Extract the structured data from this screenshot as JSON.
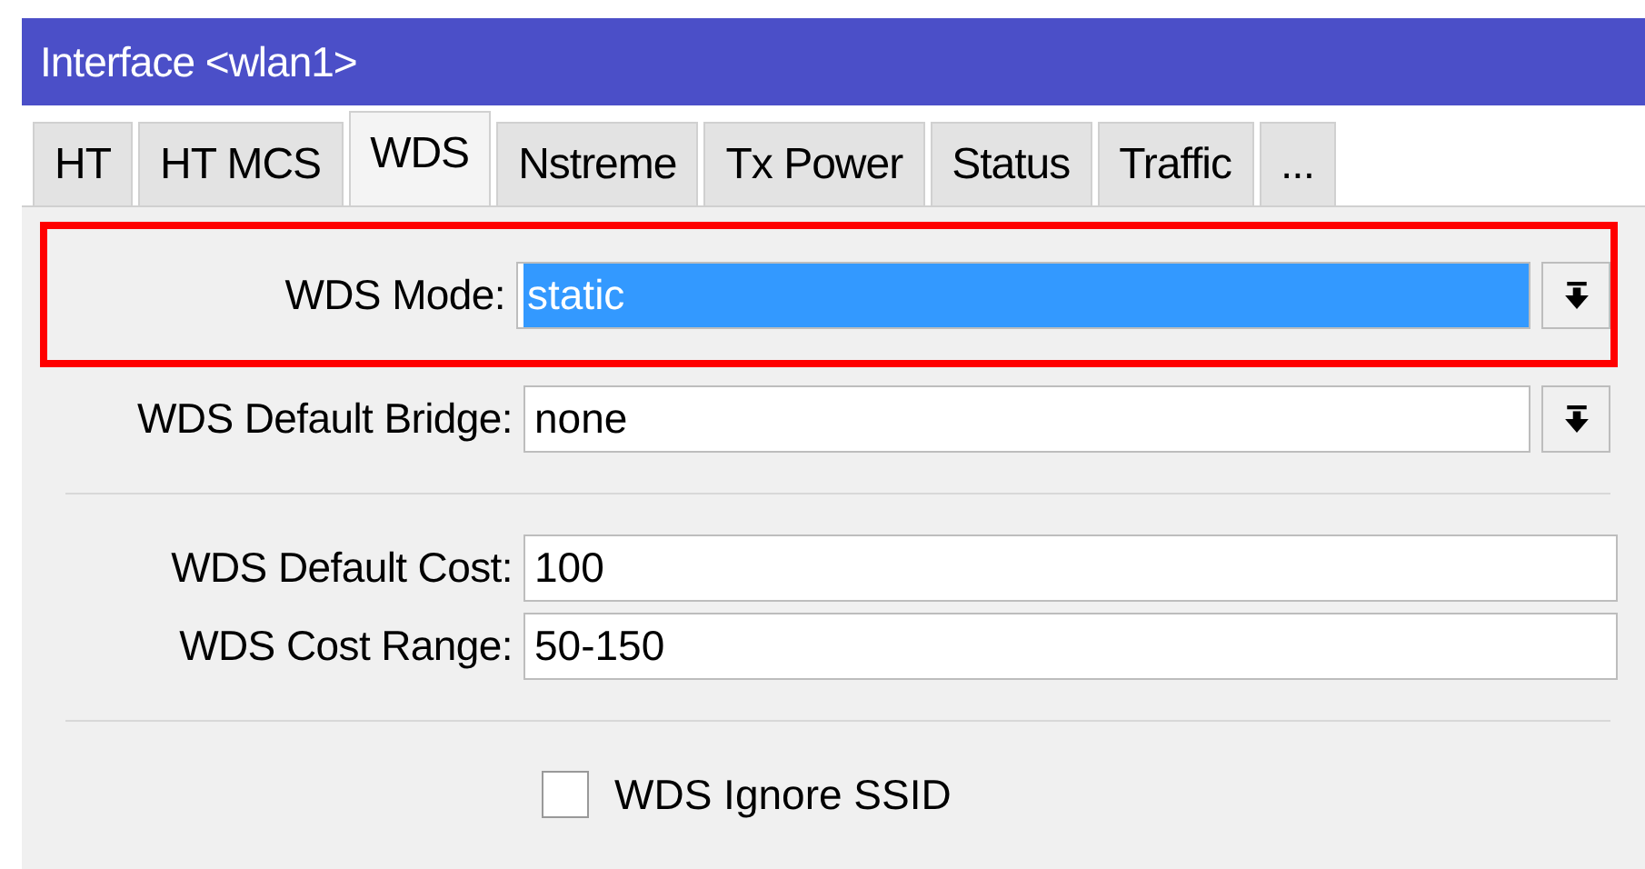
{
  "window": {
    "title": "Interface <wlan1>"
  },
  "tabs": [
    {
      "label": "HT",
      "selected": false
    },
    {
      "label": "HT MCS",
      "selected": false
    },
    {
      "label": "WDS",
      "selected": true
    },
    {
      "label": "Nstreme",
      "selected": false
    },
    {
      "label": "Tx Power",
      "selected": false
    },
    {
      "label": "Status",
      "selected": false
    },
    {
      "label": "Traffic",
      "selected": false
    },
    {
      "label": "...",
      "selected": false
    }
  ],
  "groups": [
    {
      "rows": [
        {
          "kind": "select",
          "label": "WDS Mode:",
          "value": "static",
          "focused": true,
          "highlighted": true
        },
        {
          "kind": "select",
          "label": "WDS Default Bridge:",
          "value": "none",
          "focused": false,
          "highlighted": false
        }
      ]
    },
    {
      "rows": [
        {
          "kind": "text",
          "label": "WDS Default Cost:",
          "value": "100",
          "focused": false,
          "highlighted": false
        },
        {
          "kind": "text",
          "label": "WDS Cost Range:",
          "value": "50-150",
          "focused": false,
          "highlighted": false
        }
      ]
    },
    {
      "rows": [
        {
          "kind": "checkbox",
          "label": "WDS Ignore SSID",
          "checked": false
        }
      ]
    }
  ]
}
